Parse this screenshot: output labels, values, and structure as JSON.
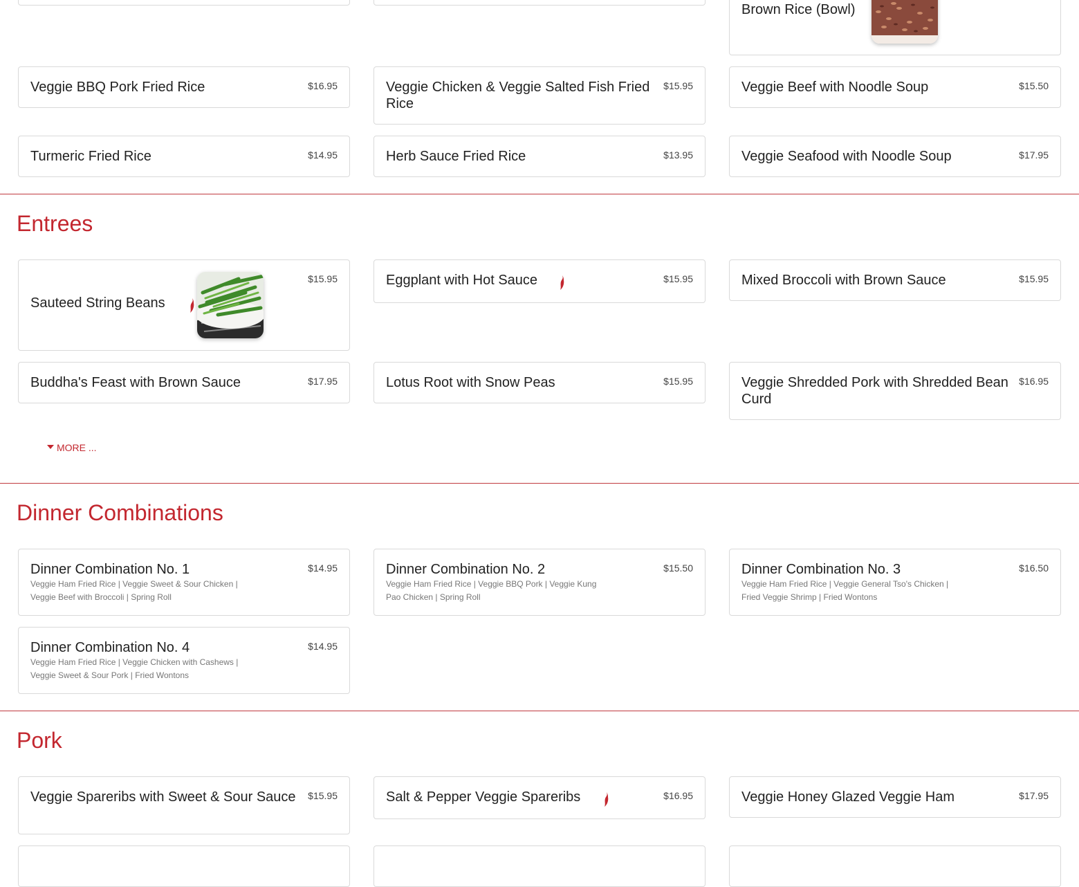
{
  "top_partial": {
    "brown_rice_name": "Brown Rice (Bowl)"
  },
  "rice_noodles": [
    {
      "name": "Veggie BBQ Pork Fried Rice",
      "price": "$16.95"
    },
    {
      "name": "Veggie Chicken & Veggie Salted Fish Fried Rice",
      "price": "$15.95"
    },
    {
      "name": "Veggie Beef with Noodle Soup",
      "price": "$15.50"
    },
    {
      "name": "Turmeric Fried Rice",
      "price": "$14.95"
    },
    {
      "name": "Herb Sauce Fried Rice",
      "price": "$13.95"
    },
    {
      "name": "Veggie Seafood with Noodle Soup",
      "price": "$17.95"
    }
  ],
  "entrees": {
    "title": "Entrees",
    "items": [
      {
        "name": "Sauteed String Beans",
        "price": "$15.95",
        "spicy": true,
        "image": "string-beans-photo"
      },
      {
        "name": "Eggplant with Hot Sauce",
        "price": "$15.95",
        "spicy": true
      },
      {
        "name": "Mixed Broccoli with Brown Sauce",
        "price": "$15.95"
      },
      {
        "name": "Buddha's Feast with Brown Sauce",
        "price": "$17.95"
      },
      {
        "name": "Lotus Root with Snow Peas",
        "price": "$15.95"
      },
      {
        "name": "Veggie Shredded Pork with Shredded Bean Curd",
        "price": "$16.95"
      }
    ],
    "more_label": "MORE ..."
  },
  "dinner_combinations": {
    "title": "Dinner Combinations",
    "items": [
      {
        "name": "Dinner Combination No. 1",
        "price": "$14.95",
        "desc1": "Veggie Ham Fried Rice | Veggie Sweet & Sour Chicken |",
        "desc2": "Veggie Beef with Broccoli | Spring Roll"
      },
      {
        "name": "Dinner Combination No. 2",
        "price": "$15.50",
        "desc1": "Veggie Ham Fried Rice | Veggie BBQ Pork | Veggie Kung",
        "desc2": "Pao Chicken | Spring Roll"
      },
      {
        "name": "Dinner Combination No. 3",
        "price": "$16.50",
        "desc1": "Veggie Ham Fried Rice | Veggie General Tso's Chicken |",
        "desc2": "Fried Veggie Shrimp | Fried Wontons"
      },
      {
        "name": "Dinner Combination No. 4",
        "price": "$14.95",
        "desc1": "Veggie Ham Fried Rice | Veggie Chicken with Cashews |",
        "desc2": "Veggie Sweet & Sour Pork | Fried Wontons"
      }
    ]
  },
  "pork": {
    "title": "Pork",
    "items": [
      {
        "name": "Veggie Spareribs with Sweet & Sour Sauce",
        "price": "$15.95"
      },
      {
        "name": "Salt & Pepper Veggie Spareribs",
        "price": "$16.95",
        "spicy": true
      },
      {
        "name": "Veggie Honey Glazed Veggie Ham",
        "price": "$17.95"
      }
    ]
  },
  "colors": {
    "accent": "#c3272f",
    "divider": "#c0393f",
    "border": "#d9d9d9"
  }
}
